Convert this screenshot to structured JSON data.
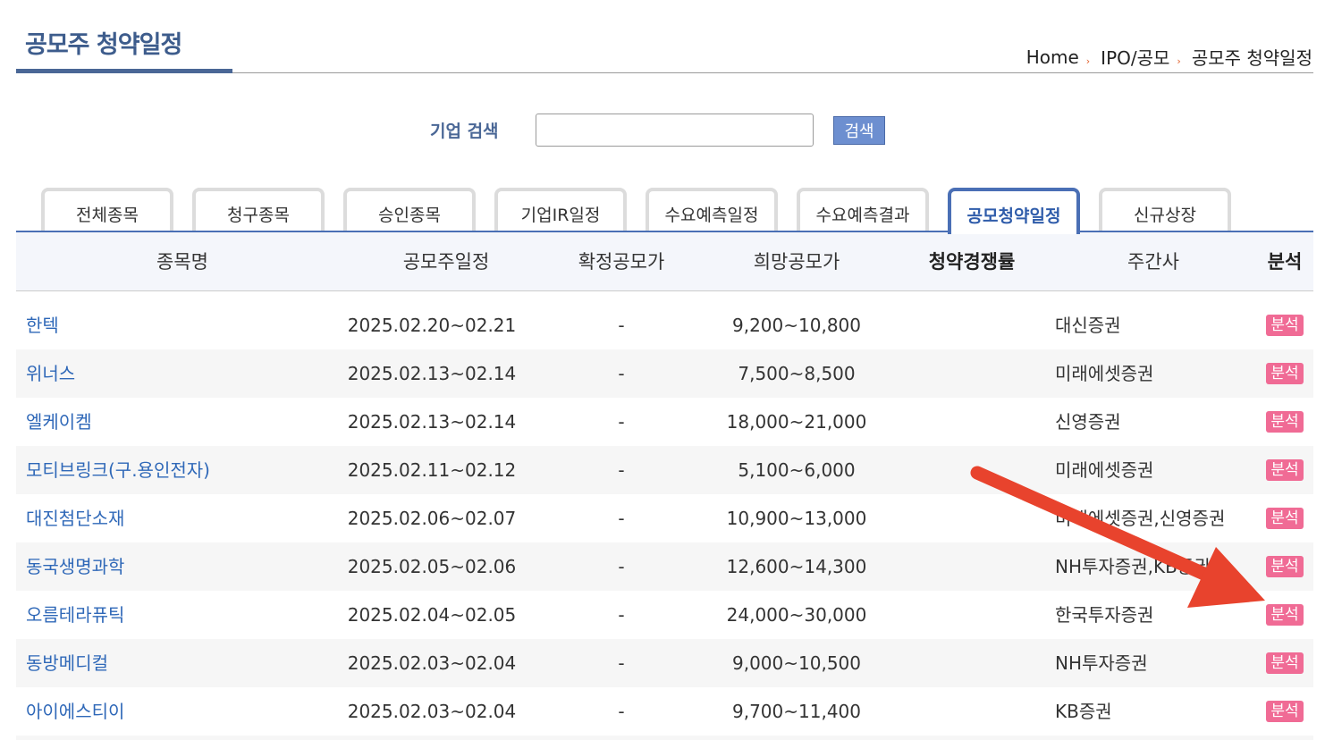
{
  "page": {
    "title": "공모주 청약일정",
    "breadcrumb": [
      "Home",
      "IPO/공모",
      "공모주 청약일정"
    ],
    "breadcrumb_separator": "›"
  },
  "search": {
    "label": "기업 검색",
    "value": "",
    "placeholder": "",
    "button_label": "검색"
  },
  "tabs": [
    {
      "label": "전체종목",
      "active": false
    },
    {
      "label": "청구종목",
      "active": false
    },
    {
      "label": "승인종목",
      "active": false
    },
    {
      "label": "기업IR일정",
      "active": false
    },
    {
      "label": "수요예측일정",
      "active": false
    },
    {
      "label": "수요예측결과",
      "active": false
    },
    {
      "label": "공모청약일정",
      "active": true
    },
    {
      "label": "신규상장",
      "active": false
    }
  ],
  "table": {
    "headers": [
      "종목명",
      "공모주일정",
      "확정공모가",
      "희망공모가",
      "청약경쟁률",
      "주간사",
      "분석"
    ],
    "rows": [
      {
        "name": "한텍",
        "schedule": "2025.02.20~02.21",
        "confirmed_price": "-",
        "desired_price": "9,200~10,800",
        "competition": "",
        "underwriter": "대신증권",
        "analysis": "분석"
      },
      {
        "name": "위너스",
        "schedule": "2025.02.13~02.14",
        "confirmed_price": "-",
        "desired_price": "7,500~8,500",
        "competition": "",
        "underwriter": "미래에셋증권",
        "analysis": "분석"
      },
      {
        "name": "엘케이켐",
        "schedule": "2025.02.13~02.14",
        "confirmed_price": "-",
        "desired_price": "18,000~21,000",
        "competition": "",
        "underwriter": "신영증권",
        "analysis": "분석"
      },
      {
        "name": "모티브링크(구.용인전자)",
        "schedule": "2025.02.11~02.12",
        "confirmed_price": "-",
        "desired_price": "5,100~6,000",
        "competition": "",
        "underwriter": "미래에셋증권",
        "analysis": "분석"
      },
      {
        "name": "대진첨단소재",
        "schedule": "2025.02.06~02.07",
        "confirmed_price": "-",
        "desired_price": "10,900~13,000",
        "competition": "",
        "underwriter": "미래에셋증권,신영증권",
        "analysis": "분석"
      },
      {
        "name": "동국생명과학",
        "schedule": "2025.02.05~02.06",
        "confirmed_price": "-",
        "desired_price": "12,600~14,300",
        "competition": "",
        "underwriter": "NH투자증권,KB증권",
        "analysis": "분석"
      },
      {
        "name": "오름테라퓨틱",
        "schedule": "2025.02.04~02.05",
        "confirmed_price": "-",
        "desired_price": "24,000~30,000",
        "competition": "",
        "underwriter": "한국투자증권",
        "analysis": "분석"
      },
      {
        "name": "동방메디컬",
        "schedule": "2025.02.03~02.04",
        "confirmed_price": "-",
        "desired_price": "9,000~10,500",
        "competition": "",
        "underwriter": "NH투자증권",
        "analysis": "분석"
      },
      {
        "name": "아이에스티이",
        "schedule": "2025.02.03~02.04",
        "confirmed_price": "-",
        "desired_price": "9,700~11,400",
        "competition": "",
        "underwriter": "KB증권",
        "analysis": "분석"
      }
    ]
  },
  "colors": {
    "title_blue": "#3d5c8c",
    "link_blue": "#2f68b8",
    "active_tab_blue": "#4a6fb5",
    "search_button": "#6d8fd0",
    "analysis_badge": "#f06b95",
    "annotation_arrow": "#e8432d"
  },
  "annotation": {
    "type": "arrow",
    "icon": "red-arrow-icon"
  }
}
